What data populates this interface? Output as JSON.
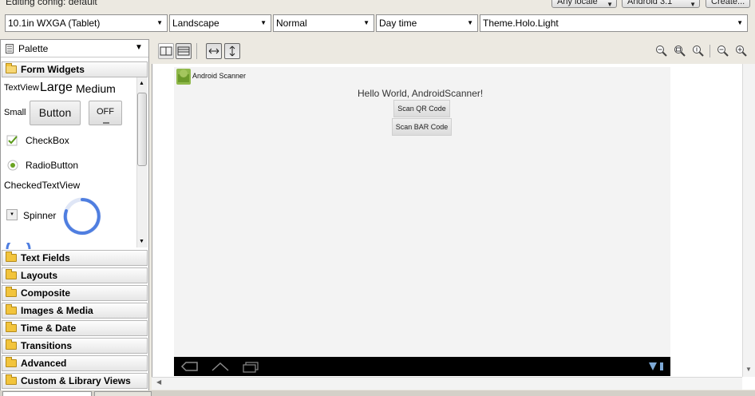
{
  "config": {
    "label": "Editing config: default",
    "locale": "Any locale",
    "android": "Android 3.1",
    "create": "Create...",
    "device": "10.1in WXGA (Tablet)",
    "orientation": "Landscape",
    "mode": "Normal",
    "time": "Day time",
    "theme": "Theme.Holo.Light"
  },
  "palette": {
    "title": "Palette",
    "open_category": "Form Widgets",
    "widgets": {
      "textview": "TextView",
      "large": "Large",
      "medium": "Medium",
      "small": "Small",
      "button": "Button",
      "toggle": "OFF",
      "checkbox": "CheckBox",
      "radiobutton": "RadioButton",
      "checkedtextview": "CheckedTextView",
      "spinner": "Spinner"
    },
    "categories": [
      "Text Fields",
      "Layouts",
      "Composite",
      "Images & Media",
      "Time & Date",
      "Transitions",
      "Advanced",
      "Custom & Library Views"
    ]
  },
  "device_screen": {
    "app_name": "Android Scanner",
    "hello": "Hello World, AndroidScanner!",
    "btn_qr": "Scan QR Code",
    "btn_bar": "Scan BAR Code"
  }
}
